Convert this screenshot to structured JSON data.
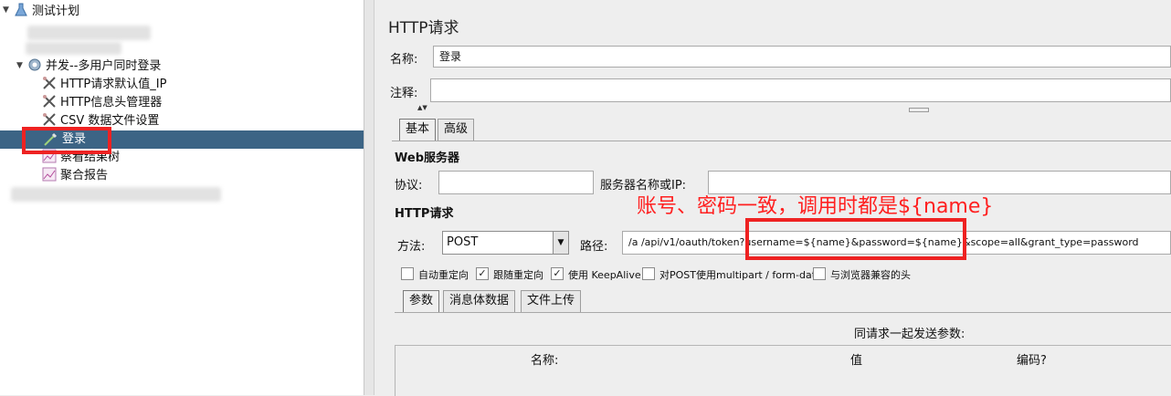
{
  "tree": {
    "root": "测试计划",
    "thread_group": "并发--多用户同时登录",
    "items": [
      "HTTP请求默认值_IP",
      "HTTP信息头管理器",
      "CSV 数据文件设置",
      "登录",
      "察看结果树",
      "聚合报告"
    ]
  },
  "panel": {
    "title": "HTTP请求",
    "name_label": "名称:",
    "name_value": "登录",
    "comment_label": "注释:",
    "comment_value": "",
    "tabs": [
      "基本",
      "高级"
    ],
    "web_server": {
      "heading": "Web服务器",
      "protocol_label": "协议:",
      "protocol_value": "",
      "server_label": "服务器名称或IP:",
      "server_value": ""
    },
    "http_request": {
      "heading": "HTTP请求",
      "method_label": "方法:",
      "method_value": "POST",
      "path_label": "路径:",
      "path_value": "/a    /api/v1/oauth/token?username=${name}&password=${name}&scope=all&grant_type=password"
    },
    "options": {
      "auto_redirect": "自动重定向",
      "follow_redirect": "跟随重定向",
      "keepalive": "使用 KeepAlive",
      "multipart": "对POST使用multipart / form-data",
      "browser_headers": "与浏览器兼容的头"
    },
    "sub_tabs": [
      "参数",
      "消息体数据",
      "文件上传"
    ],
    "params": {
      "caption": "同请求一起发送参数:",
      "col_name": "名称:",
      "col_value": "值",
      "col_encode": "编码?"
    }
  },
  "annotation": "账号、密码一致，调用时都是${name}",
  "colors": {
    "selection": "#3c6485",
    "annotation": "#ff2020"
  }
}
